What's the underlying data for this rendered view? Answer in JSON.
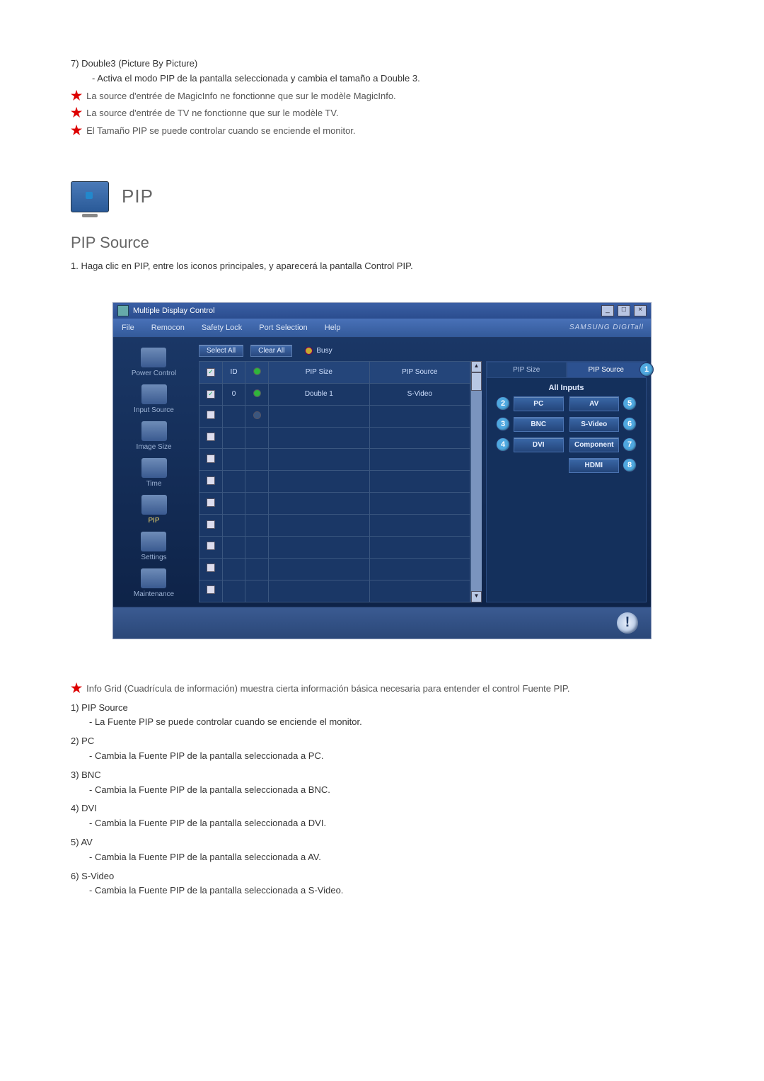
{
  "top": {
    "item7_title": "7)  Double3 (Picture By Picture)",
    "item7_sub": "- Activa el modo PIP de la pantalla seleccionada y cambia el tamaño a Double 3.",
    "star1": "La source d'entrée de MagicInfo ne fonctionne que sur le modèle MagicInfo.",
    "star2": "La source d'entrée de TV ne fonctionne que sur le modèle TV.",
    "star3": "El Tamaño PIP se puede controlar cuando se enciende el monitor."
  },
  "section": {
    "pip_heading": "PIP",
    "pip_source_heading": "PIP Source",
    "intro_line": "1.  Haga clic en PIP, entre los iconos principales, y aparecerá la pantalla Control PIP."
  },
  "app": {
    "title": "Multiple Display Control",
    "menu": {
      "file": "File",
      "remocon": "Remocon",
      "safety": "Safety Lock",
      "port": "Port Selection",
      "help": "Help"
    },
    "brand": "SAMSUNG DIGITall",
    "sidebar": {
      "power": "Power Control",
      "input": "Input Source",
      "image": "Image Size",
      "time": "Time",
      "pip": "PIP",
      "settings": "Settings",
      "maint": "Maintenance"
    },
    "toolbar": {
      "select_all": "Select All",
      "clear_all": "Clear All",
      "busy": "Busy"
    },
    "grid": {
      "col_chk": "",
      "col_id": "ID",
      "col_status": "",
      "col_pipsize": "PIP Size",
      "col_pipsource": "PIP Source",
      "row0_id": "0",
      "row0_pipsize": "Double 1",
      "row0_pipsource": "S-Video"
    },
    "panel": {
      "tab_left": "PIP Size",
      "tab_right": "PIP Source",
      "header": "All Inputs",
      "sources": {
        "pc": "PC",
        "av": "AV",
        "bnc": "BNC",
        "svideo": "S-Video",
        "dvi": "DVI",
        "component": "Component",
        "hdmi": "HDMI"
      },
      "badges": {
        "b1": "1",
        "b2": "2",
        "b3": "3",
        "b4": "4",
        "b5": "5",
        "b6": "6",
        "b7": "7",
        "b8": "8"
      }
    }
  },
  "bottom": {
    "star_intro": "Info Grid (Cuadrícula de información) muestra cierta información básica necesaria para entender el control Fuente PIP.",
    "i1_h": "1)  PIP Source",
    "i1_s": "- La Fuente PIP se puede controlar cuando se enciende el monitor.",
    "i2_h": "2)  PC",
    "i2_s": "- Cambia la Fuente PIP de la pantalla seleccionada a PC.",
    "i3_h": "3)  BNC",
    "i3_s": "- Cambia la Fuente PIP de la pantalla seleccionada a BNC.",
    "i4_h": "4)  DVI",
    "i4_s": "- Cambia la Fuente PIP de la pantalla seleccionada a DVI.",
    "i5_h": "5)  AV",
    "i5_s": "- Cambia la Fuente PIP de la pantalla seleccionada a AV.",
    "i6_h": "6)  S-Video",
    "i6_s": "- Cambia la Fuente PIP de la pantalla seleccionada a S-Video."
  }
}
